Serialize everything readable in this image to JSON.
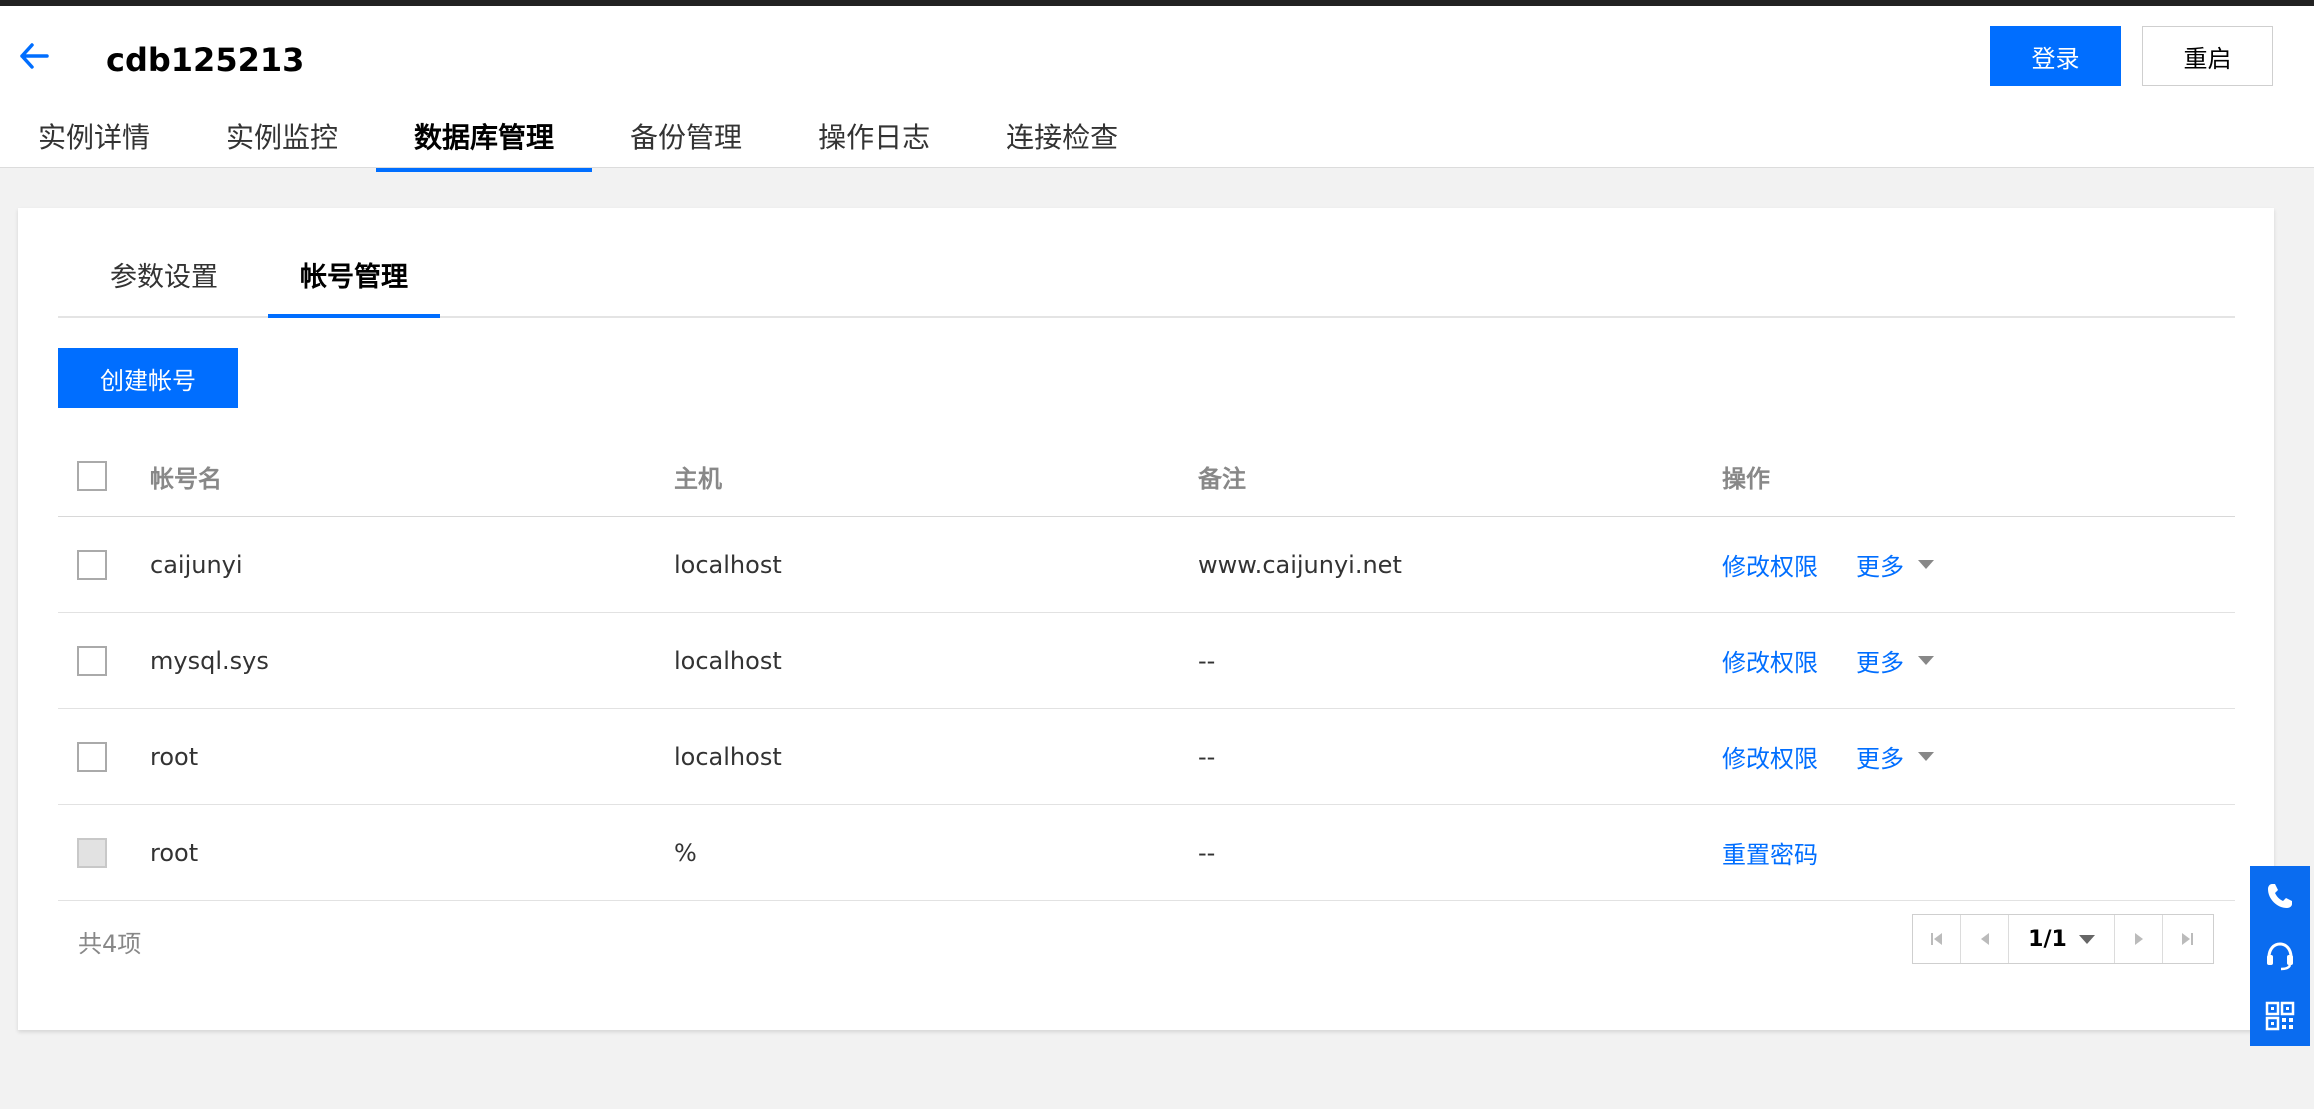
{
  "header": {
    "title": "cdb125213",
    "login_button": "登录",
    "restart_button": "重启"
  },
  "main_tabs": [
    "实例详情",
    "实例监控",
    "数据库管理",
    "备份管理",
    "操作日志",
    "连接检查"
  ],
  "sub_tabs": [
    "参数设置",
    "帐号管理"
  ],
  "create_button": "创建帐号",
  "table": {
    "headers": {
      "name": "帐号名",
      "host": "主机",
      "note": "备注",
      "op": "操作"
    },
    "rows": [
      {
        "name": "caijunyi",
        "host": "localhost",
        "note": "www.caijunyi.net",
        "op": "修改权限",
        "more": "更多"
      },
      {
        "name": "mysql.sys",
        "host": "localhost",
        "note": "--",
        "op": "修改权限",
        "more": "更多"
      },
      {
        "name": "root",
        "host": "localhost",
        "note": "--",
        "op": "修改权限",
        "more": "更多"
      },
      {
        "name": "root",
        "host": "%",
        "note": "--",
        "op": "重置密码"
      }
    ]
  },
  "pagination": {
    "total": "共4项",
    "page": "1/1"
  },
  "colors": {
    "accent": "#006eff",
    "float_bar": "#0a6cf0"
  },
  "float_icons": [
    "phone-icon",
    "headset-icon",
    "qr-code-icon"
  ]
}
